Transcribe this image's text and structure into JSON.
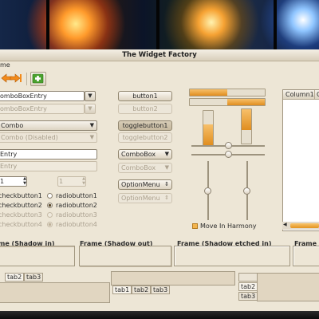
{
  "window": {
    "title": "The Widget Factory"
  },
  "menubar": {
    "visible_text": "me"
  },
  "toolbar": {
    "buttons": [
      {
        "icon": "arrow-left-icon",
        "color": "#f28a1a"
      },
      {
        "icon": "arrow-right-end-icon",
        "color": "#f28a1a"
      },
      {
        "icon": "add-icon",
        "color": "#4aa22e"
      }
    ]
  },
  "left_column": {
    "combobox_entry": {
      "value": "omboBoxEntry"
    },
    "combobox_entry_disabled": {
      "value": "omboBoxEntry"
    },
    "combo": {
      "value": "Combo"
    },
    "combo_disabled": {
      "value": "Combo (Disabled)"
    },
    "entry": {
      "value": "Entry"
    },
    "entry_disabled": {
      "value": "Entry"
    },
    "spin": {
      "value": "1"
    },
    "spin_disabled": {
      "value": "1"
    },
    "checks": [
      {
        "label": "checkbutton1",
        "checked": false,
        "disabled": false
      },
      {
        "label": "checkbutton2",
        "checked": true,
        "disabled": false
      },
      {
        "label": "checkbutton3",
        "checked": false,
        "disabled": true
      },
      {
        "label": "checkbutton4",
        "checked": true,
        "disabled": true
      }
    ],
    "radios": [
      {
        "label": "radiobutton1",
        "checked": false,
        "disabled": false
      },
      {
        "label": "radiobutton2",
        "checked": true,
        "disabled": false
      },
      {
        "label": "radiobutton3",
        "checked": false,
        "disabled": true
      },
      {
        "label": "radiobutton4",
        "checked": true,
        "disabled": true
      }
    ]
  },
  "middle_column": {
    "button1": "button1",
    "button2": "button2",
    "togglebutton1": "togglebutton1",
    "togglebutton2": "togglebutton2",
    "combobox": "ComboBox",
    "combobox_disabled": "ComboBox",
    "optionmenu": "OptionMenu",
    "optionmenu_disabled": "OptionMenu"
  },
  "progress": {
    "horizontal": [
      {
        "fraction": 0.5
      },
      {
        "fraction": 0.5
      }
    ],
    "vertical": [
      {
        "fraction": 0.6
      },
      {
        "fraction": 0.6
      }
    ]
  },
  "scales": {
    "horizontal": [
      {
        "value": 0.5
      },
      {
        "value": 0.5
      }
    ],
    "vertical": [
      {
        "value": 0.5
      },
      {
        "value": 0.5
      }
    ]
  },
  "move_in_harmony": {
    "label": "Move In Harmony",
    "checked": true
  },
  "treeview": {
    "columns": [
      "Column1",
      "C"
    ]
  },
  "frames": [
    {
      "title": "me (Shadow in)"
    },
    {
      "title": "Frame (Shadow out)"
    },
    {
      "title": "Frame (Shadow etched in)"
    },
    {
      "title": "Frame"
    }
  ],
  "notebooks": [
    {
      "tabs": [
        "tab2",
        "tab3"
      ]
    },
    {
      "tabs": [
        "tab1",
        "tab2",
        "tab3"
      ]
    },
    {
      "tabs": [
        "tab2",
        "tab3"
      ]
    }
  ],
  "colors": {
    "accent": "#f0a030",
    "window_bg": "#ede6d6"
  }
}
